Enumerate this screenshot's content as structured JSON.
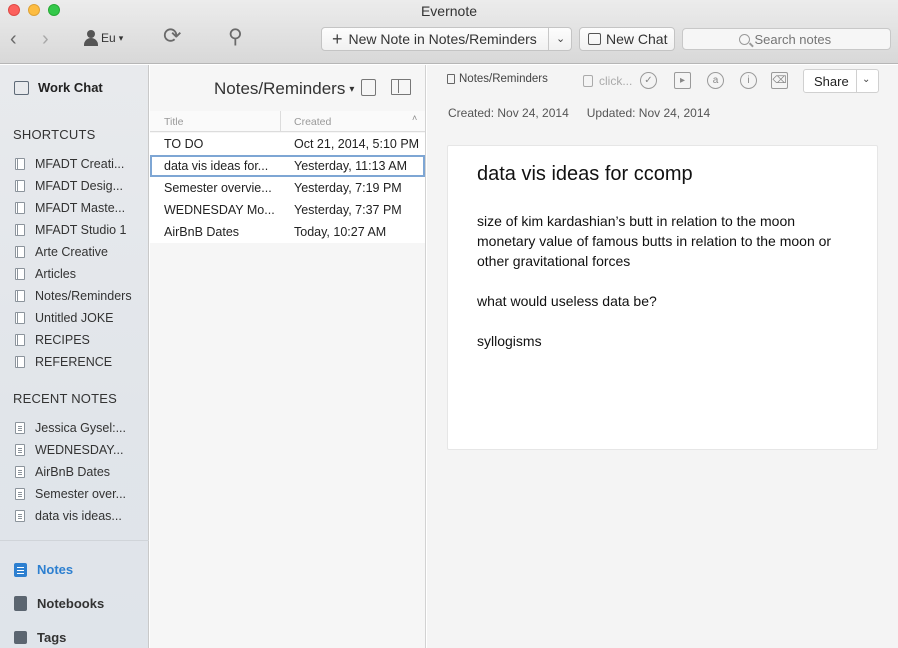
{
  "window": {
    "title": "Evernote"
  },
  "toolbar": {
    "account": "Eu",
    "new_note_label": "New Note in Notes/Reminders",
    "new_chat_label": "New Chat",
    "search_placeholder": "Search notes"
  },
  "sidebar": {
    "work_chat": "Work Chat",
    "shortcuts_heading": "SHORTCUTS",
    "shortcuts": [
      "MFADT Creati...",
      "MFADT Desig...",
      "MFADT Maste...",
      "MFADT Studio 1",
      "Arte Creative",
      "Articles",
      "Notes/Reminders",
      "Untitled JOKE",
      "RECIPES",
      "REFERENCE"
    ],
    "recent_heading": "RECENT NOTES",
    "recent": [
      "Jessica Gysel:...",
      "WEDNESDAY...",
      "AirBnB Dates",
      "Semester over...",
      "data vis ideas..."
    ],
    "nav": {
      "notes": "Notes",
      "notebooks": "Notebooks",
      "tags": "Tags"
    }
  },
  "note_list": {
    "title": "Notes/Reminders",
    "columns": {
      "title": "Title",
      "created": "Created"
    },
    "rows": [
      {
        "title": "TO DO",
        "created": "Oct 21, 2014, 5:10 PM"
      },
      {
        "title": "data vis ideas for...",
        "created": "Yesterday, 11:13 AM"
      },
      {
        "title": "Semester overvie...",
        "created": "Yesterday, 7:19 PM"
      },
      {
        "title": "WEDNESDAY Mo...",
        "created": "Yesterday, 7:37 PM"
      },
      {
        "title": "AirBnB Dates",
        "created": "Today, 10:27 AM"
      }
    ],
    "selected_index": 1
  },
  "note": {
    "notebook": "Notes/Reminders",
    "tag_placeholder": "click...",
    "share_label": "Share",
    "created": "Created: Nov 24, 2014",
    "updated": "Updated: Nov 24, 2014",
    "title": "data vis ideas for ccomp",
    "lines": [
      "size of kim kardashian’s butt in relation to the moon",
      "monetary value of famous butts in relation to the moon or other gravitational forces",
      "what would useless data be?",
      "syllogisms"
    ]
  },
  "colors": {
    "accent": "#2d7fd0",
    "selection_border": "#7ea6d4"
  },
  "icons": {
    "back": "chevron-left-icon",
    "forward": "chevron-right-icon",
    "sync": "sync-icon",
    "activity": "activity-icon",
    "info": "info-icon",
    "trash": "trash-icon"
  }
}
